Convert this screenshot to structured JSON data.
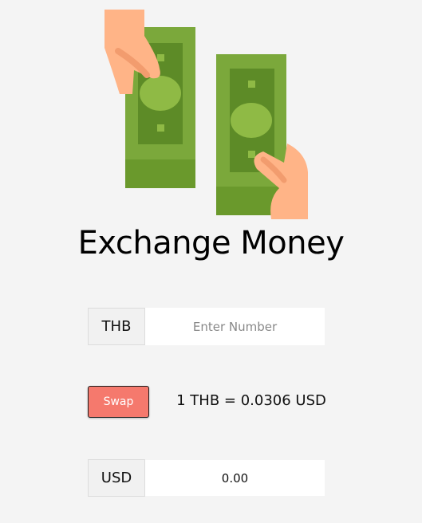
{
  "title": "Exchange Money",
  "from": {
    "currency": "THB",
    "placeholder": "Enter Number"
  },
  "swap_label": "Swap",
  "rate_text": "1 THB = 0.0306 USD",
  "to": {
    "currency": "USD",
    "value": "0.00"
  },
  "icon": "money-exchange-illustration",
  "colors": {
    "swap_button": "#f5796d",
    "bill_green": "#7ba83b",
    "skin": "#ffb487",
    "background": "#f4f4f4"
  }
}
